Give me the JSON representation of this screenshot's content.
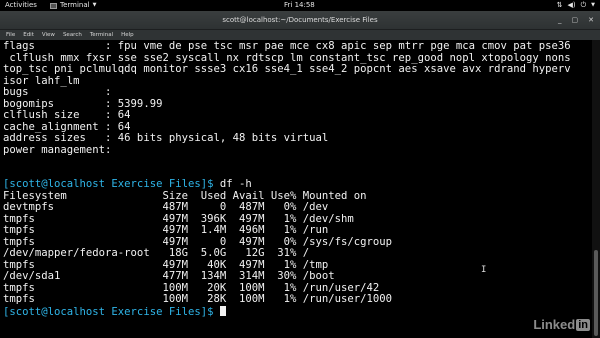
{
  "topbar": {
    "activities": "Activities",
    "app_name": "Terminal",
    "clock": "Fri 14:58"
  },
  "window": {
    "title": "scott@localhost:~/Documents/Exercise Files"
  },
  "menubar": [
    "File",
    "Edit",
    "View",
    "Search",
    "Terminal",
    "Help"
  ],
  "terminal_lines": [
    {
      "text": "flags           : fpu vme de pse tsc msr pae mce cx8 apic sep mtrr pge mca cmov pat pse36"
    },
    {
      "text": " clflush mmx fxsr sse sse2 syscall nx rdtscp lm constant_tsc rep_good nopl xtopology nons"
    },
    {
      "text": "top_tsc pni pclmulqdq monitor ssse3 cx16 sse4_1 sse4_2 popcnt aes xsave avx rdrand hyperv"
    },
    {
      "text": "isor lahf_lm"
    },
    {
      "text": "bugs            :"
    },
    {
      "text": "bogomips        : 5399.99"
    },
    {
      "text": "clflush size    : 64"
    },
    {
      "text": "cache_alignment : 64"
    },
    {
      "text": "address sizes   : 46 bits physical, 48 bits virtual"
    },
    {
      "text": "power management:"
    },
    {
      "text": ""
    },
    {
      "text": ""
    },
    {
      "prompt": "[scott@localhost Exercise Files]$",
      "text": " df -h"
    },
    {
      "text": "Filesystem               Size  Used Avail Use% Mounted on"
    },
    {
      "text": "devtmpfs                 487M     0  487M   0% /dev"
    },
    {
      "text": "tmpfs                    497M  396K  497M   1% /dev/shm"
    },
    {
      "text": "tmpfs                    497M  1.4M  496M   1% /run"
    },
    {
      "text": "tmpfs                    497M     0  497M   0% /sys/fs/cgroup"
    },
    {
      "text": "/dev/mapper/fedora-root   18G  5.0G   12G  31% /"
    },
    {
      "text": "tmpfs                    497M   40K  497M   1% /tmp"
    },
    {
      "text": "/dev/sda1                477M  134M  314M  30% /boot"
    },
    {
      "text": "tmpfs                    100M   20K  100M   1% /run/user/42"
    },
    {
      "text": "tmpfs                    100M   28K  100M   1% /run/user/1000"
    },
    {
      "prompt": "[scott@localhost Exercise Files]$",
      "text": " ",
      "cursor": true
    }
  ],
  "watermark": {
    "text": "Linked",
    "badge": "in"
  },
  "colors": {
    "prompt": "#2fb5e8",
    "background": "#000000",
    "foreground": "#f2f2f2"
  }
}
